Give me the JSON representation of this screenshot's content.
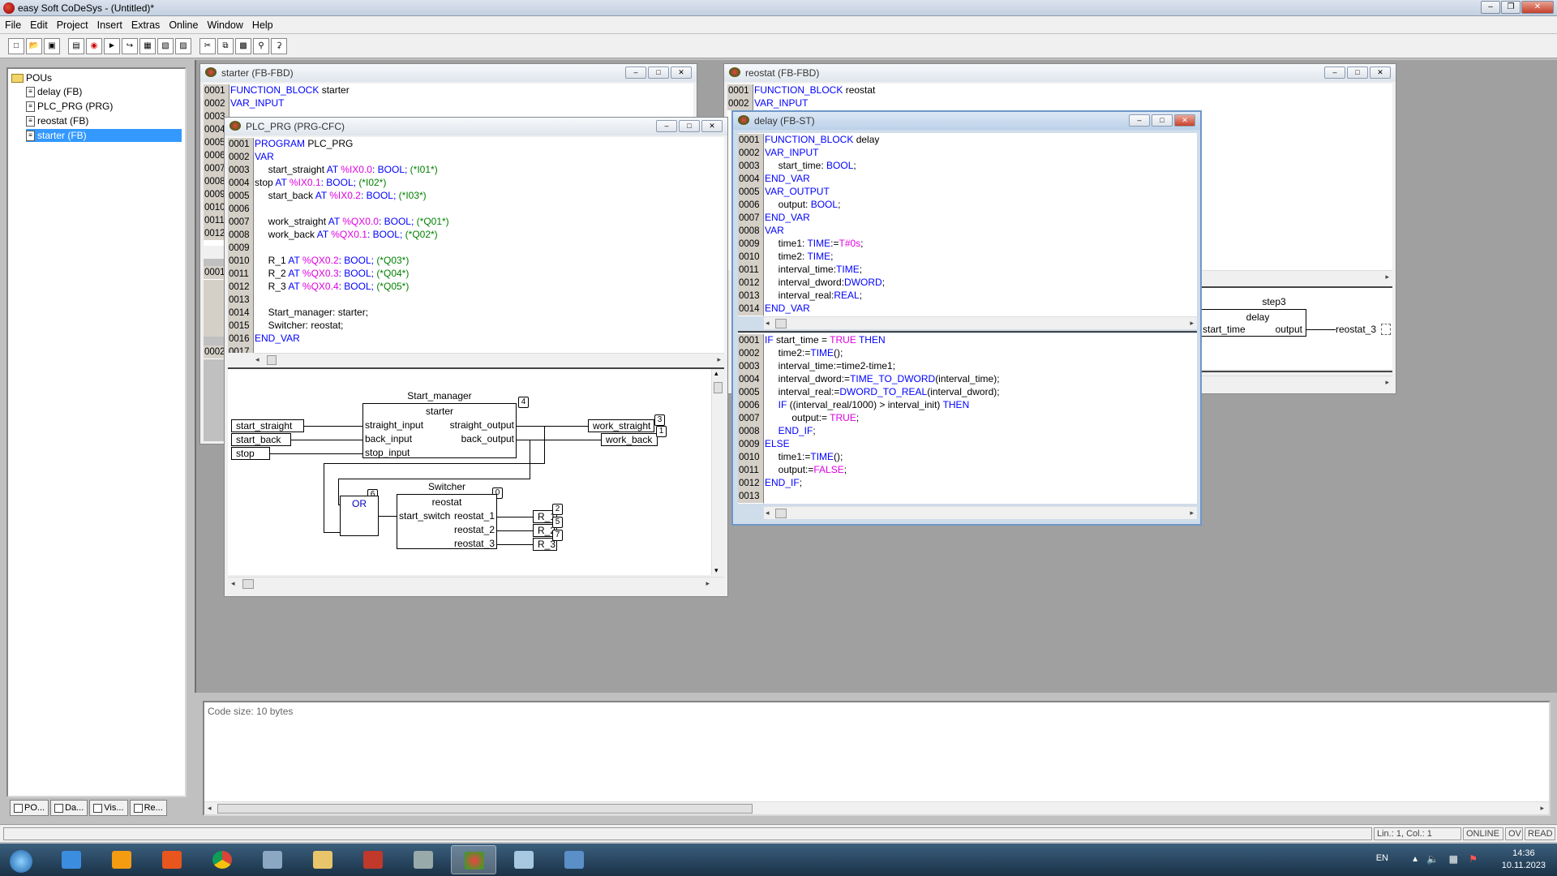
{
  "window": {
    "title": "easy Soft CoDeSys - (Untitled)*"
  },
  "menu": [
    "File",
    "Edit",
    "Project",
    "Insert",
    "Extras",
    "Online",
    "Window",
    "Help"
  ],
  "tree": {
    "root": "POUs",
    "items": [
      "delay (FB)",
      "PLC_PRG (PRG)",
      "reostat (FB)",
      "starter (FB)"
    ],
    "selected_index": 3
  },
  "left_tabs": [
    "PO...",
    "Da...",
    "Vis...",
    "Re..."
  ],
  "windows": {
    "starter": {
      "title": "starter (FB-FBD)",
      "lines": [
        {
          "n": "0001",
          "kw": "FUNCTION_BLOCK",
          "rest": " starter"
        },
        {
          "n": "0002",
          "kw": "VAR_INPUT",
          "rest": ""
        },
        {
          "n": "0003",
          "kw": "",
          "rest": ""
        },
        {
          "n": "0004",
          "kw": "",
          "rest": ""
        },
        {
          "n": "0005",
          "kw": "",
          "rest": ""
        },
        {
          "n": "0006",
          "kw": "",
          "rest": ""
        },
        {
          "n": "0007",
          "kw": "",
          "rest": ""
        },
        {
          "n": "0008",
          "kw": "",
          "rest": ""
        },
        {
          "n": "0009",
          "kw": "",
          "rest": ""
        },
        {
          "n": "0010",
          "kw": "",
          "rest": ""
        },
        {
          "n": "0011",
          "kw": "",
          "rest": ""
        },
        {
          "n": "0012",
          "kw": "",
          "rest": ""
        }
      ],
      "net_numbers": [
        "0001",
        "0002"
      ]
    },
    "reostat": {
      "title": "reostat (FB-FBD)",
      "lines": [
        {
          "n": "0001",
          "kw": "FUNCTION_BLOCK",
          "rest": " reostat"
        },
        {
          "n": "0002",
          "kw": "VAR_INPUT",
          "rest": ""
        }
      ],
      "block": {
        "instance": "step3",
        "type": "delay",
        "in": "start_time",
        "out": "output",
        "target": "reostat_3"
      }
    },
    "plc_prg": {
      "title": "PLC_PRG (PRG-CFC)",
      "lines": [
        {
          "n": "0001",
          "parts": [
            [
              "kw",
              "PROGRAM"
            ],
            [
              "t",
              " PLC_PRG"
            ]
          ]
        },
        {
          "n": "0002",
          "parts": [
            [
              "kw",
              "VAR"
            ]
          ]
        },
        {
          "n": "0003",
          "parts": [
            [
              "t",
              "     start_straight "
            ],
            [
              "kw",
              "AT "
            ],
            [
              "addr",
              "%IX0.0"
            ],
            [
              "kw",
              ": BOOL; "
            ],
            [
              "cmt",
              "(*I01*)"
            ]
          ]
        },
        {
          "n": "0004",
          "parts": [
            [
              "t",
              "stop "
            ],
            [
              "kw",
              "AT "
            ],
            [
              "addr",
              "%IX0.1"
            ],
            [
              "kw",
              ": BOOL; "
            ],
            [
              "cmt",
              "(*I02*)"
            ]
          ]
        },
        {
          "n": "0005",
          "parts": [
            [
              "t",
              "     start_back "
            ],
            [
              "kw",
              "AT "
            ],
            [
              "addr",
              "%IX0.2"
            ],
            [
              "kw",
              ": BOOL; "
            ],
            [
              "cmt",
              "(*I03*)"
            ]
          ]
        },
        {
          "n": "0006",
          "parts": []
        },
        {
          "n": "0007",
          "parts": [
            [
              "t",
              "     work_straight "
            ],
            [
              "kw",
              "AT "
            ],
            [
              "addr",
              "%QX0.0"
            ],
            [
              "kw",
              ": BOOL; "
            ],
            [
              "cmt",
              "(*Q01*)"
            ]
          ]
        },
        {
          "n": "0008",
          "parts": [
            [
              "t",
              "     work_back "
            ],
            [
              "kw",
              "AT "
            ],
            [
              "addr",
              "%QX0.1"
            ],
            [
              "kw",
              ": BOOL; "
            ],
            [
              "cmt",
              "(*Q02*)"
            ]
          ]
        },
        {
          "n": "0009",
          "parts": []
        },
        {
          "n": "0010",
          "parts": [
            [
              "t",
              "     R_1 "
            ],
            [
              "kw",
              "AT "
            ],
            [
              "addr",
              "%QX0.2"
            ],
            [
              "kw",
              ": BOOL; "
            ],
            [
              "cmt",
              "(*Q03*)"
            ]
          ]
        },
        {
          "n": "0011",
          "parts": [
            [
              "t",
              "     R_2 "
            ],
            [
              "kw",
              "AT "
            ],
            [
              "addr",
              "%QX0.3"
            ],
            [
              "kw",
              ": BOOL; "
            ],
            [
              "cmt",
              "(*Q04*)"
            ]
          ]
        },
        {
          "n": "0012",
          "parts": [
            [
              "t",
              "     R_3 "
            ],
            [
              "kw",
              "AT "
            ],
            [
              "addr",
              "%QX0.4"
            ],
            [
              "kw",
              ": BOOL; "
            ],
            [
              "cmt",
              "(*Q05*)"
            ]
          ]
        },
        {
          "n": "0013",
          "parts": []
        },
        {
          "n": "0014",
          "parts": [
            [
              "t",
              "     Start_manager: starter;"
            ]
          ]
        },
        {
          "n": "0015",
          "parts": [
            [
              "t",
              "     Switcher: reostat;"
            ]
          ]
        },
        {
          "n": "0016",
          "parts": [
            [
              "kw",
              "END_VAR"
            ]
          ]
        },
        {
          "n": "0017",
          "parts": []
        }
      ],
      "cfc": {
        "inputs": [
          "start_straight",
          "start_back",
          "stop"
        ],
        "start_manager": {
          "instance": "Start_manager",
          "type": "starter",
          "inputs": [
            "straight_input",
            "back_input",
            "stop_input"
          ],
          "outputs": [
            "straight_output",
            "back_output"
          ],
          "order": "4"
        },
        "outputs": [
          {
            "name": "work_straight",
            "order": "3"
          },
          {
            "name": "work_back",
            "order": "1"
          }
        ],
        "or_block": {
          "label": "OR",
          "order": "6"
        },
        "switcher": {
          "instance": "Switcher",
          "type": "reostat",
          "input": "start_switch",
          "outputs": [
            "reostat_1",
            "reostat_2",
            "reostat_3"
          ],
          "order": "0"
        },
        "r_outputs": [
          {
            "name": "R_1",
            "order": "2"
          },
          {
            "name": "R_2",
            "order": "5"
          },
          {
            "name": "R_3",
            "order": "7"
          }
        ]
      }
    },
    "delay": {
      "title": "delay (FB-ST)",
      "decl": [
        {
          "n": "0001",
          "parts": [
            [
              "kw",
              "FUNCTION_BLOCK"
            ],
            [
              "t",
              " delay"
            ]
          ]
        },
        {
          "n": "0002",
          "parts": [
            [
              "kw",
              "VAR_INPUT"
            ]
          ]
        },
        {
          "n": "0003",
          "parts": [
            [
              "t",
              "     start_time: "
            ],
            [
              "kw",
              "BOOL"
            ],
            [
              "t",
              ";"
            ]
          ]
        },
        {
          "n": "0004",
          "parts": [
            [
              "kw",
              "END_VAR"
            ]
          ]
        },
        {
          "n": "0005",
          "parts": [
            [
              "kw",
              "VAR_OUTPUT"
            ]
          ]
        },
        {
          "n": "0006",
          "parts": [
            [
              "t",
              "     output: "
            ],
            [
              "kw",
              "BOOL"
            ],
            [
              "t",
              ";"
            ]
          ]
        },
        {
          "n": "0007",
          "parts": [
            [
              "kw",
              "END_VAR"
            ]
          ]
        },
        {
          "n": "0008",
          "parts": [
            [
              "kw",
              "VAR"
            ]
          ]
        },
        {
          "n": "0009",
          "parts": [
            [
              "t",
              "     time1: "
            ],
            [
              "kw",
              "TIME"
            ],
            [
              "t",
              ":="
            ],
            [
              "addr",
              "T#0s"
            ],
            [
              "t",
              ";"
            ]
          ]
        },
        {
          "n": "0010",
          "parts": [
            [
              "t",
              "     time2: "
            ],
            [
              "kw",
              "TIME"
            ],
            [
              "t",
              ";"
            ]
          ]
        },
        {
          "n": "0011",
          "parts": [
            [
              "t",
              "     interval_time:"
            ],
            [
              "kw",
              "TIME"
            ],
            [
              "t",
              ";"
            ]
          ]
        },
        {
          "n": "0012",
          "parts": [
            [
              "t",
              "     interval_dword:"
            ],
            [
              "kw",
              "DWORD"
            ],
            [
              "t",
              ";"
            ]
          ]
        },
        {
          "n": "0013",
          "parts": [
            [
              "t",
              "     interval_real:"
            ],
            [
              "kw",
              "REAL"
            ],
            [
              "t",
              ";"
            ]
          ]
        },
        {
          "n": "0014",
          "parts": [
            [
              "kw",
              "END_VAR"
            ]
          ]
        }
      ],
      "body": [
        {
          "n": "0001",
          "parts": [
            [
              "kw",
              "IF"
            ],
            [
              "t",
              " start_time = "
            ],
            [
              "addr",
              "TRUE"
            ],
            [
              "kw",
              " THEN"
            ]
          ]
        },
        {
          "n": "0002",
          "parts": [
            [
              "t",
              "     time2:="
            ],
            [
              "kw",
              "TIME"
            ],
            [
              "t",
              "();"
            ]
          ]
        },
        {
          "n": "0003",
          "parts": [
            [
              "t",
              "     interval_time:=time2-time1;"
            ]
          ]
        },
        {
          "n": "0004",
          "parts": [
            [
              "t",
              "     interval_dword:="
            ],
            [
              "kw",
              "TIME_TO_DWORD"
            ],
            [
              "t",
              "(interval_time);"
            ]
          ]
        },
        {
          "n": "0005",
          "parts": [
            [
              "t",
              "     interval_real:="
            ],
            [
              "kw",
              "DWORD_TO_REAL"
            ],
            [
              "t",
              "(interval_dword);"
            ]
          ]
        },
        {
          "n": "0006",
          "parts": [
            [
              "kw",
              "     IF"
            ],
            [
              "t",
              " ((interval_real/1000) > interval_init) "
            ],
            [
              "kw",
              "THEN"
            ]
          ]
        },
        {
          "n": "0007",
          "parts": [
            [
              "t",
              "          output:= "
            ],
            [
              "addr",
              "TRUE"
            ],
            [
              "t",
              ";"
            ]
          ]
        },
        {
          "n": "0008",
          "parts": [
            [
              "kw",
              "     END_IF"
            ],
            [
              "t",
              ";"
            ]
          ]
        },
        {
          "n": "0009",
          "parts": [
            [
              "kw",
              "ELSE"
            ]
          ]
        },
        {
          "n": "0010",
          "parts": [
            [
              "t",
              "     time1:="
            ],
            [
              "kw",
              "TIME"
            ],
            [
              "t",
              "();"
            ]
          ]
        },
        {
          "n": "0011",
          "parts": [
            [
              "t",
              "     output:="
            ],
            [
              "addr",
              "FALSE"
            ],
            [
              "t",
              ";"
            ]
          ]
        },
        {
          "n": "0012",
          "parts": [
            [
              "kw",
              "END_IF"
            ],
            [
              "t",
              ";"
            ]
          ]
        },
        {
          "n": "0013",
          "parts": []
        }
      ]
    }
  },
  "messages": {
    "text": "Code size: 10 bytes"
  },
  "status": {
    "position": "Lin.: 1, Col.: 1",
    "online": "ONLINE",
    "ov": "OV",
    "read": "READ"
  },
  "taskbar": {
    "lang": "EN",
    "time": "14:36",
    "date": "10.11.2023"
  }
}
